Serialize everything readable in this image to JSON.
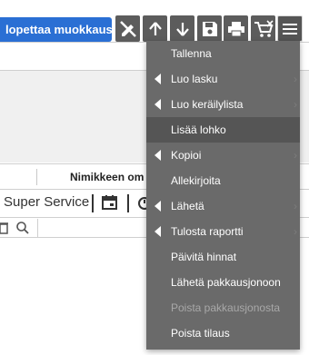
{
  "toolbar": {
    "edit_button_label": "lopettaa muokkaus",
    "icons": [
      "remove-edit-icon",
      "arrow-up-icon",
      "arrow-down-icon",
      "save-icon",
      "print-icon",
      "cart-icon",
      "hamburger-menu-icon"
    ]
  },
  "page": {
    "column_header": "Nimikkeen om",
    "service_label": "Super Service"
  },
  "menu": {
    "items": [
      {
        "label": "Tallenna"
      },
      {
        "label": "Luo lasku"
      },
      {
        "label": "Luo keräilylista"
      },
      {
        "label": "Lisää lohko"
      },
      {
        "label": "Kopioi"
      },
      {
        "label": "Allekirjoita"
      },
      {
        "label": "Lähetä"
      },
      {
        "label": "Tulosta raportti"
      },
      {
        "label": "Päivitä hinnat"
      },
      {
        "label": "Lähetä pakkausjonoon"
      },
      {
        "label": "Poista pakkausjonosta"
      },
      {
        "label": "Poista tilaus"
      }
    ]
  },
  "colors": {
    "accent": "#2a6fd4",
    "toolbar_icon_bg": "#5c5c5c",
    "menu_bg": "#6a6a6a",
    "menu_active_bg": "#555555",
    "menu_disabled_text": "#a8a8a8"
  }
}
